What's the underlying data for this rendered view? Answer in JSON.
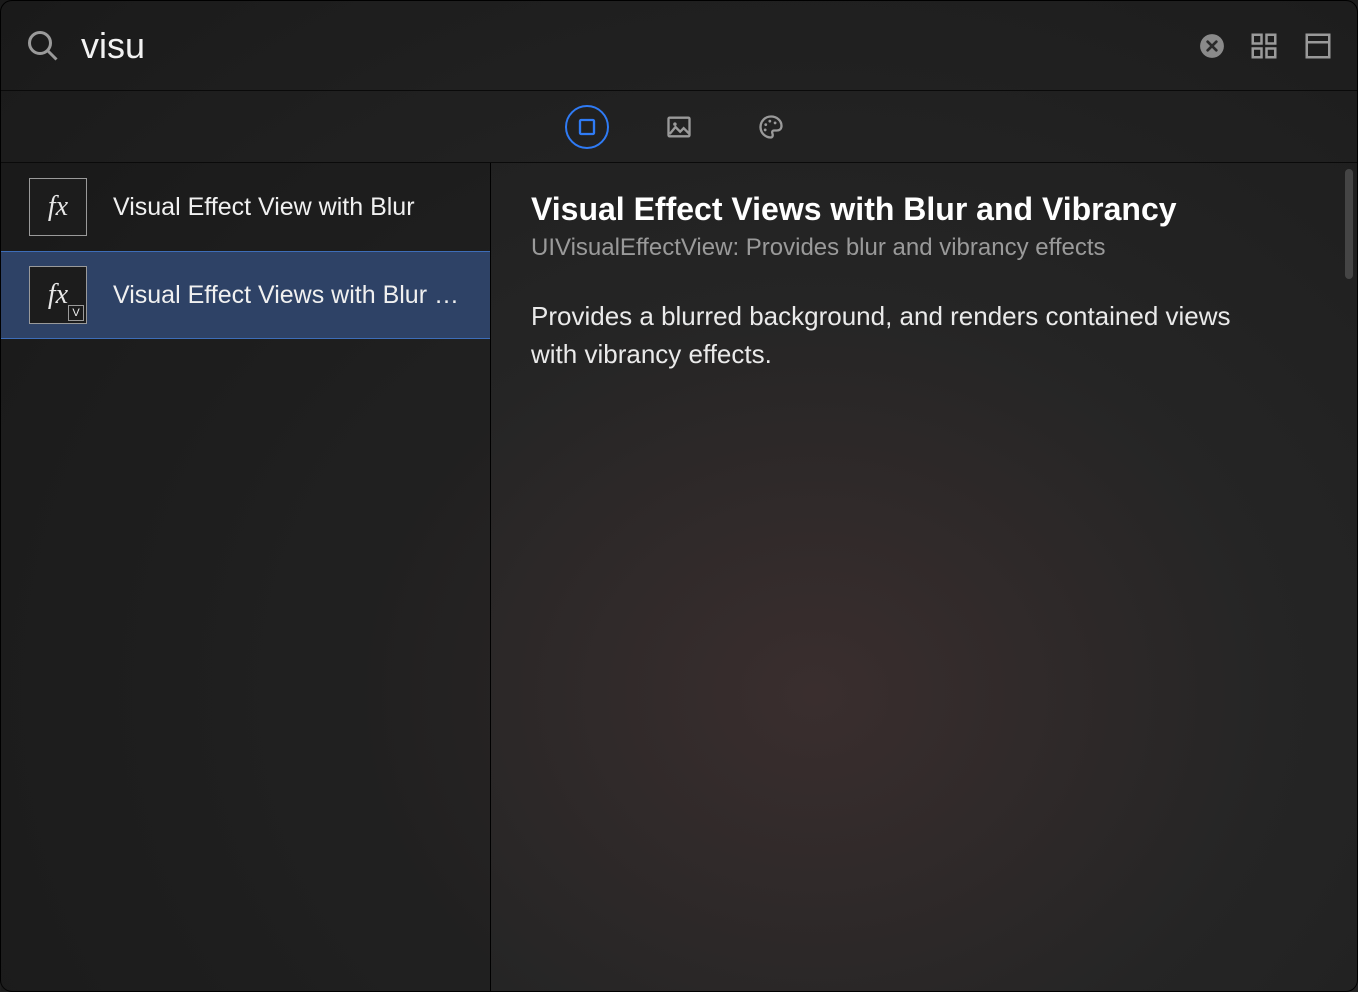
{
  "search": {
    "value": "visu"
  },
  "tabs": {
    "objects_active": true
  },
  "list": {
    "items": [
      {
        "label": "Visual Effect View with Blur",
        "selected": false,
        "variant": "plain"
      },
      {
        "label": "Visual Effect Views with Blur and Vibrancy",
        "selected": true,
        "variant": "v"
      }
    ]
  },
  "detail": {
    "title": "Visual Effect Views with Blur and Vibrancy",
    "subtitle": "UIVisualEffectView: Provides blur and vibrancy effects",
    "description": "Provides a blurred background, and renders contained views with vibrancy effects."
  }
}
